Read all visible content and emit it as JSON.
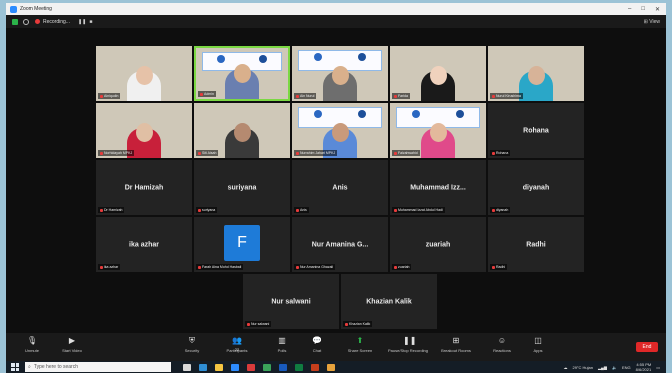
{
  "window": {
    "title": "Zoom Meeting"
  },
  "topbar": {
    "recording_label": "Recording...",
    "view_label": "View"
  },
  "tiles": [
    {
      "kind": "video",
      "label": "Ainiqudin",
      "skin": "#e6c2a8",
      "scarf": "#f0f0f0"
    },
    {
      "kind": "video-banner",
      "label": "Admin",
      "skin": "#d9b08c",
      "scarf": "#6a7fb0",
      "speaker": true
    },
    {
      "kind": "video-banner",
      "label": "Ain Nurul",
      "skin": "#d9b08c",
      "scarf": "#6e6e6e"
    },
    {
      "kind": "video",
      "label": "Farida",
      "skin": "#f0d2bd",
      "scarf": "#1a1a1a"
    },
    {
      "kind": "video",
      "label": "Nurul Kirushima",
      "skin": "#d7b398",
      "scarf": "#2aa7c8"
    },
    {
      "kind": "video",
      "label": "Norhidayah MPKJ",
      "skin": "#e0bfa4",
      "scarf": "#c8203a"
    },
    {
      "kind": "video",
      "label": "Siti Aisah",
      "skin": "#b58a70",
      "scarf": "#3a3a3a"
    },
    {
      "kind": "video-banner",
      "label": "Nurrahim Jahari MPKJ",
      "skin": "#c99a7b",
      "scarf": "#5a8ad8"
    },
    {
      "kind": "video-banner",
      "label": "Faizahwahid",
      "skin": "#e3b99c",
      "scarf": "#e04a8a"
    },
    {
      "kind": "name",
      "name": "Rohana",
      "label": "Rohana"
    },
    {
      "kind": "name",
      "name": "Dr Hamizah",
      "label": "Dr Hamizah"
    },
    {
      "kind": "name",
      "name": "suriyana",
      "label": "suriyana"
    },
    {
      "kind": "name",
      "name": "Anis",
      "label": "Anis"
    },
    {
      "kind": "name",
      "name": "Muhammad Izz...",
      "label": "Muhammad Izzat Abdul Hadi"
    },
    {
      "kind": "name",
      "name": "diyanah",
      "label": "diyanah"
    },
    {
      "kind": "name",
      "name": "ika azhar",
      "label": "ika azhar"
    },
    {
      "kind": "avatar",
      "letter": "F",
      "label": "Farah Aina Mohd Hasbali"
    },
    {
      "kind": "name",
      "name": "Nur Amanina G...",
      "label": "Nur Amanina Ghazali"
    },
    {
      "kind": "name",
      "name": "zuariah",
      "label": "zuariah"
    },
    {
      "kind": "name",
      "name": "Radhi",
      "label": "Radhi"
    },
    {
      "kind": "name",
      "name": "Nur salwani",
      "label": "Nur salwani"
    },
    {
      "kind": "name",
      "name": "Khazian Kalik",
      "label": "Khazian Kalik"
    }
  ],
  "controls": {
    "unmute": "Unmute",
    "start_video": "Start Video",
    "security": "Security",
    "participants": "Participants",
    "participants_count": "22",
    "polls": "Polls",
    "chat": "Chat",
    "share_screen": "Share Screen",
    "record": "Pause/Stop Recording",
    "breakout": "Breakout Rooms",
    "reactions": "Reactions",
    "apps": "Apps",
    "end": "End"
  },
  "taskbar": {
    "search_placeholder": "Type here to search",
    "weather": "29°C Hujan",
    "lang": "ENG",
    "time": "4:55 PM",
    "date": "8/6/2021"
  },
  "colors": {
    "speaker_border": "#7bd843",
    "end_button": "#e02828",
    "share_screen": "#2bb34a"
  }
}
